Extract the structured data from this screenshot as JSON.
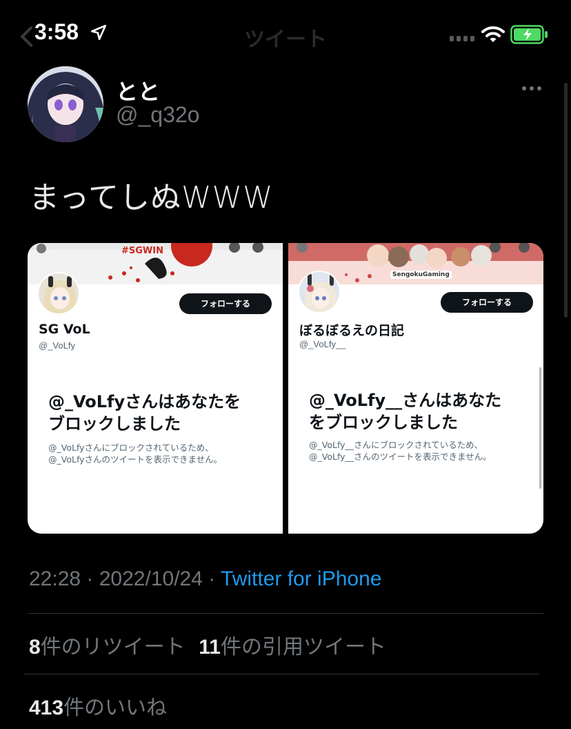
{
  "status_bar": {
    "time": "3:58",
    "nav_title": "ツイート"
  },
  "tweet": {
    "display_name": "とと",
    "handle": "@_q32o",
    "text": "まってしぬWWW"
  },
  "media": [
    {
      "banner_text": "#SGWIN",
      "name": "SG VoL",
      "handle": "@_VoLfy",
      "follow_label": "フォローする",
      "blocked_title_line1": "@_VoLfyさんはあなたを",
      "blocked_title_line2": "ブロックしました",
      "blocked_sub_line1": "@_VoLfyさんにブロックされているため、",
      "blocked_sub_line2": "@_VoLfyさんのツイートを表示できません。"
    },
    {
      "banner_text": "SengokuGaming",
      "name": "ぼるぼるえの日記",
      "handle": "@_VoLfy__",
      "follow_label": "フォローする",
      "blocked_title_line1": "@_VoLfy__さんはあなた",
      "blocked_title_line2": "をブロックしました",
      "blocked_sub_line1": "@_VoLfy__さんにブロックされているため、",
      "blocked_sub_line2": "@_VoLfy__さんのツイートを表示できません。"
    }
  ],
  "meta": {
    "time": "22:28",
    "sep1": " · ",
    "date": "2022/10/24",
    "sep2": " · ",
    "source": "Twitter for iPhone"
  },
  "stats": {
    "retweets_count": "8",
    "retweets_label": "件のリツイート",
    "quotes_count": "11",
    "quotes_label": "件の引用ツイート",
    "likes_count": "413",
    "likes_label": "件のいいね"
  },
  "colors": {
    "background": "#000000",
    "link": "#1d9bf0",
    "muted": "#71767b",
    "battery": "#4cd964"
  },
  "icons": {
    "back": "chevron-left-icon",
    "location": "location-arrow-icon",
    "signal": "cellular-signal-icon",
    "wifi": "wifi-icon",
    "battery": "battery-charging-icon",
    "more": "more-horizontal-icon"
  }
}
